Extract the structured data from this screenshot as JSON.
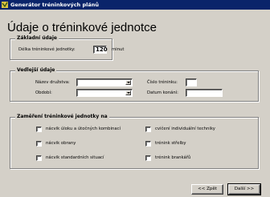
{
  "window": {
    "title": "Generátor tréninkových plánů"
  },
  "page": {
    "heading": "Údaje o tréninkové jednotce"
  },
  "basic": {
    "legend": "Základní údaje",
    "length_label": "Délka tréninkové jednotky:",
    "length_value": "120",
    "length_unit": "minut"
  },
  "side": {
    "legend": "Vedlejší údaje",
    "team_label": "Název družstva:",
    "team_value": "",
    "period_label": "Období:",
    "period_value": "",
    "number_label": "Číslo tréninku:",
    "number_value": "",
    "date_label": "Datum konání:",
    "date_value": ""
  },
  "focus": {
    "legend": "Zaměření tréninkové jednotky na",
    "options": [
      {
        "label": "nácvik úloku a útočných kombinací",
        "checked": false
      },
      {
        "label": "cvičení individuální techniky",
        "checked": false
      },
      {
        "label": "nácvik obrany",
        "checked": false
      },
      {
        "label": "trénink střelby",
        "checked": false
      },
      {
        "label": "nácvik standardních situací",
        "checked": false
      },
      {
        "label": "trénink brankářů",
        "checked": false
      }
    ]
  },
  "buttons": {
    "back": "<< Zpět",
    "next": "Další >>"
  }
}
